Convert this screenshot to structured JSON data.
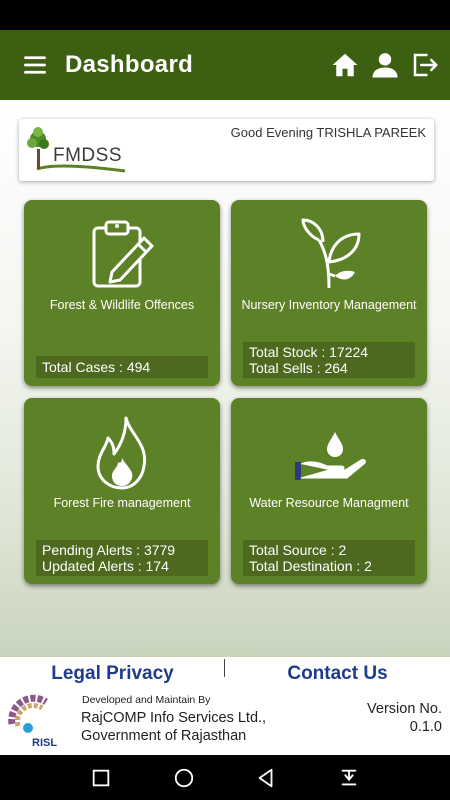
{
  "app_bar": {
    "title": "Dashboard",
    "icons": [
      "menu-icon",
      "home-icon",
      "profile-icon",
      "logout-icon"
    ]
  },
  "welcome": {
    "logo_text": "FMDSS",
    "greeting": "Good Evening TRISHLA PAREEK"
  },
  "tiles": [
    {
      "label": "Forest & Wildlife Offences",
      "icon": "clipboard-pencil-icon",
      "stats": [
        "Total Cases : 494"
      ]
    },
    {
      "label": "Nursery Inventory Management",
      "icon": "plant-icon",
      "stats": [
        "Total Stock : 17224",
        "Total Sells : 264"
      ]
    },
    {
      "label": "Forest Fire management",
      "icon": "fire-icon",
      "stats": [
        "Pending Alerts : 3779",
        "Updated Alerts : 174"
      ]
    },
    {
      "label": "Water Resource Managment",
      "icon": "water-hand-icon",
      "stats": [
        "Total Source : 2",
        "Total Destination : 2"
      ]
    }
  ],
  "footer": {
    "legal_link": "Legal Privacy",
    "contact_link": "Contact Us",
    "developed_by": "Developed and Maintain By",
    "org_line1": "RajCOMP Info Services Ltd.,",
    "org_line2": "Government of Rajasthan",
    "version_label": "Version No.",
    "version_value": "0.1.0",
    "logo_text": "RISL"
  },
  "colors": {
    "app_bar": "#3d5f12",
    "tile": "#5d8127",
    "link": "#1f3b8a"
  }
}
